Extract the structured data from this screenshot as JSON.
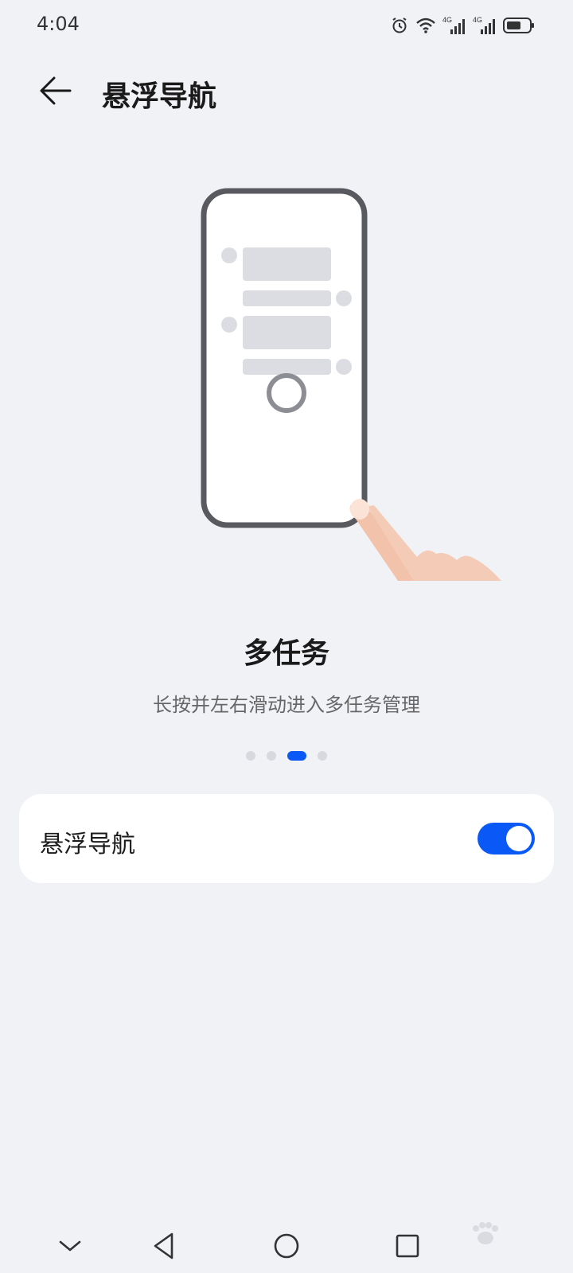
{
  "status_bar": {
    "time": "4:04",
    "icons": [
      "alarm-icon",
      "wifi-icon",
      "signal-4g-icon",
      "signal-4g-icon",
      "battery-icon"
    ],
    "network_label_1": "4G",
    "network_label_2": "4G"
  },
  "header": {
    "back_icon": "back-arrow-icon",
    "title": "悬浮导航"
  },
  "slide": {
    "title": "多任务",
    "description": "长按并左右滑动进入多任务管理",
    "page_count": 4,
    "active_index": 2
  },
  "setting": {
    "label": "悬浮导航",
    "enabled": true
  },
  "nav_bar": {
    "buttons": [
      "collapse-icon",
      "back-triangle-icon",
      "home-circle-icon",
      "recents-square-icon"
    ]
  },
  "colors": {
    "accent": "#0a59f7",
    "background": "#f1f2f6",
    "card": "#ffffff"
  }
}
